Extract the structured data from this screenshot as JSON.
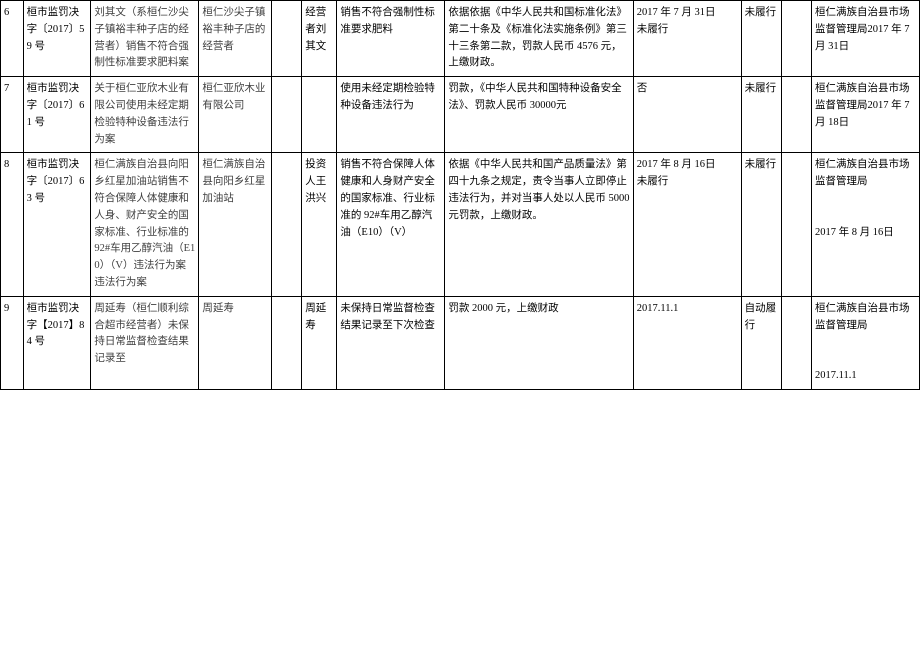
{
  "rows": [
    {
      "idx": "6",
      "docno": "桓市监罚决字〔2017〕59 号",
      "case": "刘其文（系桓仁沙尖子镇裕丰种子店的经营者）销售不符合强制性标准要求肥料案",
      "party": "桓仁沙尖子镇裕丰种子店的经营者",
      "blank1": "",
      "rep": "经营者刘其文",
      "fact": "销售不符合强制性标准要求肥料",
      "basis": "依据依据《中华人民共和国标准化法》第二十条及《标准化法实施条例》第三十三条第二款，罚款人民币 4576 元，上缴财政。",
      "date": "2017 年 7 月 31日　　未履行",
      "perf": "未履行",
      "blank2": "",
      "org": "桓仁满族自治县市场监督管理局2017 年 7 月 31日"
    },
    {
      "idx": "7",
      "docno": "桓市监罚决字〔2017〕61 号",
      "case": "关于桓仁亚欣木业有限公司使用未经定期检验特种设备违法行为案",
      "party": "桓仁亚欣木业有限公司",
      "blank1": "",
      "rep": "",
      "fact": "使用未经定期检验特种设备违法行为",
      "basis": "罚款，《中华人民共和国特种设备安全法》、罚款人民币 30000元",
      "date": "否",
      "perf": "未履行",
      "blank2": "",
      "org": "桓仁满族自治县市场监督管理局2017 年 7 月 18日"
    },
    {
      "idx": "8",
      "docno": "桓市监罚决字〔2017〕63 号",
      "case": "桓仁满族自治县向阳乡红星加油站销售不符合保障人体健康和人身、财产安全的国家标准、行业标准的 92#车用乙醇汽油（E10）（V）违法行为案违法行为案",
      "party": "桓仁满族自治县向阳乡红星加油站",
      "blank1": "",
      "rep": "投资人王洪兴",
      "fact": "销售不符合保障人体健康和人身财产安全的国家标准、行业标准的 92#车用乙醇汽油（E10）（V）",
      "basis": "依据《中华人民共和国产品质量法》第四十九条之规定，责令当事人立即停止违法行为，并对当事人处以人民币 5000 元罚款，上缴财政。",
      "date": "2017 年 8 月 16日　　未履行",
      "perf": "未履行",
      "blank2": "",
      "org": "桓仁满族自治县市场监督管理局\n\n2017 年 8 月 16日"
    },
    {
      "idx": "9",
      "docno": "桓市监罚决字【2017】84 号",
      "case": "周延寿（桓仁顺利综合超市经营者）未保持日常监督检查结果记录至",
      "party": "周延寿",
      "blank1": "",
      "rep": "周延寿",
      "fact": "未保持日常监督检查结果记录至下次检查",
      "basis": "罚款 2000 元，上缴财政",
      "date": "2017.11.1",
      "perf": "自动履行",
      "blank2": "",
      "org": "桓仁满族自治县市场监督管理局\n\n2017.11.1"
    }
  ]
}
